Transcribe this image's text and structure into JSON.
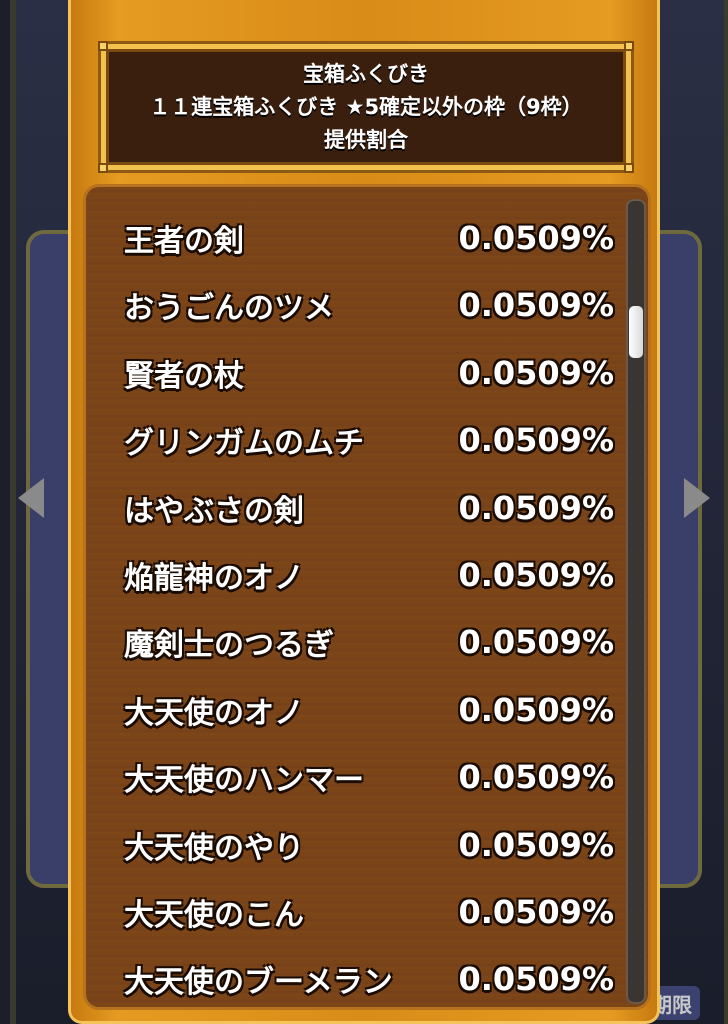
{
  "background": {
    "limit_label": "期限"
  },
  "dialog": {
    "header": {
      "line1": "宝箱ふくびき",
      "line2": "１１連宝箱ふくびき ★5確定以外の枠（9枠）",
      "line3": "提供割合"
    },
    "rates": [
      {
        "name": "王者の剣",
        "rate": "0.0509%"
      },
      {
        "name": "おうごんのツメ",
        "rate": "0.0509%"
      },
      {
        "name": "賢者の杖",
        "rate": "0.0509%"
      },
      {
        "name": "グリンガムのムチ",
        "rate": "0.0509%"
      },
      {
        "name": "はやぶさの剣",
        "rate": "0.0509%"
      },
      {
        "name": "焔龍神のオノ",
        "rate": "0.0509%"
      },
      {
        "name": "魔剣士のつるぎ",
        "rate": "0.0509%"
      },
      {
        "name": "大天使のオノ",
        "rate": "0.0509%"
      },
      {
        "name": "大天使のハンマー",
        "rate": "0.0509%"
      },
      {
        "name": "大天使のやり",
        "rate": "0.0509%"
      },
      {
        "name": "大天使のこん",
        "rate": "0.0509%"
      },
      {
        "name": "大天使のブーメラン",
        "rate": "0.0509%"
      }
    ],
    "scroll_position": 0.14
  },
  "colors": {
    "frame_gold": "#e59b22",
    "header_bg": "#3a1f0e",
    "panel_wood": "#7a4418"
  }
}
